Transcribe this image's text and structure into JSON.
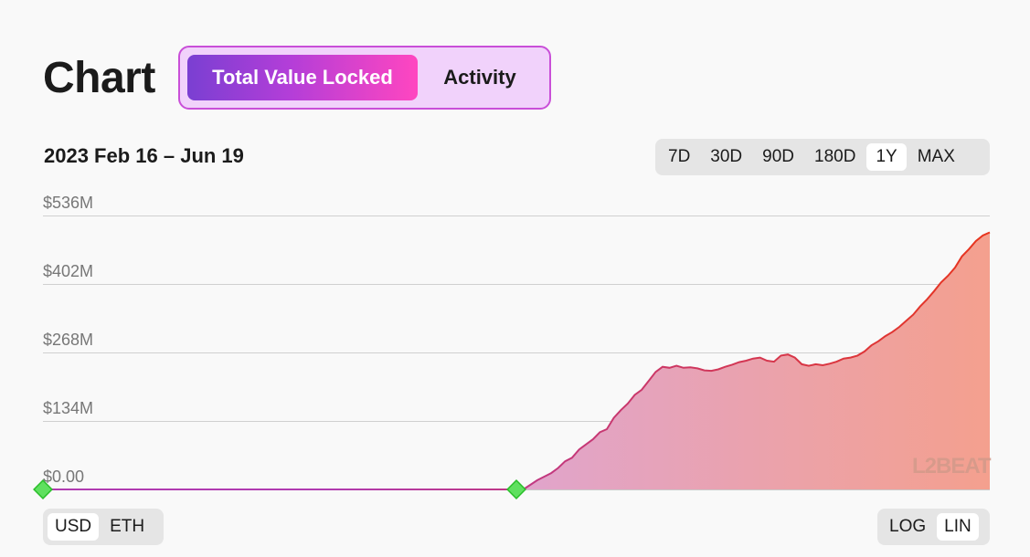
{
  "header": {
    "title": "Chart",
    "tabs": [
      {
        "label": "Total Value Locked",
        "active": true
      },
      {
        "label": "Activity",
        "active": false
      }
    ]
  },
  "date_range": "2023 Feb 16 – Jun 19",
  "time_ranges": [
    {
      "label": "7D",
      "active": false
    },
    {
      "label": "30D",
      "active": false
    },
    {
      "label": "90D",
      "active": false
    },
    {
      "label": "180D",
      "active": false
    },
    {
      "label": "1Y",
      "active": true
    },
    {
      "label": "MAX",
      "active": false
    }
  ],
  "unit_toggle": [
    {
      "label": "USD",
      "active": true
    },
    {
      "label": "ETH",
      "active": false
    }
  ],
  "scale_toggle": [
    {
      "label": "LOG",
      "active": false
    },
    {
      "label": "LIN",
      "active": true
    }
  ],
  "logo_text": "L2BEAT",
  "colors": {
    "tab_gradient_start": "#7a3fd2",
    "tab_gradient_end": "#ff46c0",
    "line_start": "#b03bb0",
    "line_end": "#e8341c",
    "area_start": "#d8a6e6",
    "area_end": "#f4a08e",
    "marker": "#5fe05f"
  },
  "chart_data": {
    "type": "area",
    "x_start": "2023-02-16",
    "x_end": "2023-06-19",
    "ylim": [
      0,
      536
    ],
    "y_unit": "$M",
    "y_ticks": [
      "$0.00",
      "$134M",
      "$268M",
      "$402M",
      "$536M"
    ],
    "grid": true,
    "values": [
      0,
      0,
      0,
      0,
      0,
      0,
      0,
      0,
      0,
      0,
      0,
      0,
      0,
      0,
      0,
      0,
      0,
      0,
      0,
      0,
      0,
      0,
      0,
      0,
      0,
      0,
      0,
      0,
      0,
      0,
      0,
      0,
      0,
      0,
      0,
      0,
      0,
      0,
      0,
      0,
      0,
      0,
      0,
      0,
      0,
      0,
      0,
      0,
      0,
      0,
      0,
      0,
      0,
      0,
      0,
      0,
      0,
      0,
      0,
      0,
      0,
      0,
      0,
      0,
      0,
      0,
      0,
      0,
      0,
      0,
      9,
      18,
      25,
      32,
      42,
      55,
      62,
      78,
      88,
      98,
      112,
      118,
      140,
      155,
      168,
      185,
      195,
      212,
      230,
      240,
      238,
      242,
      238,
      239,
      237,
      233,
      232,
      235,
      240,
      244,
      249,
      252,
      256,
      258,
      252,
      250,
      262,
      264,
      258,
      245,
      242,
      245,
      243,
      246,
      250,
      256,
      258,
      262,
      270,
      282,
      290,
      300,
      308,
      318,
      330,
      342,
      358,
      372,
      388,
      405,
      418,
      434,
      456,
      470,
      486,
      497,
      503
    ],
    "markers": [
      {
        "date": "2023-02-16",
        "index": 0
      },
      {
        "date": "2023-04-18",
        "index": 68
      }
    ]
  }
}
